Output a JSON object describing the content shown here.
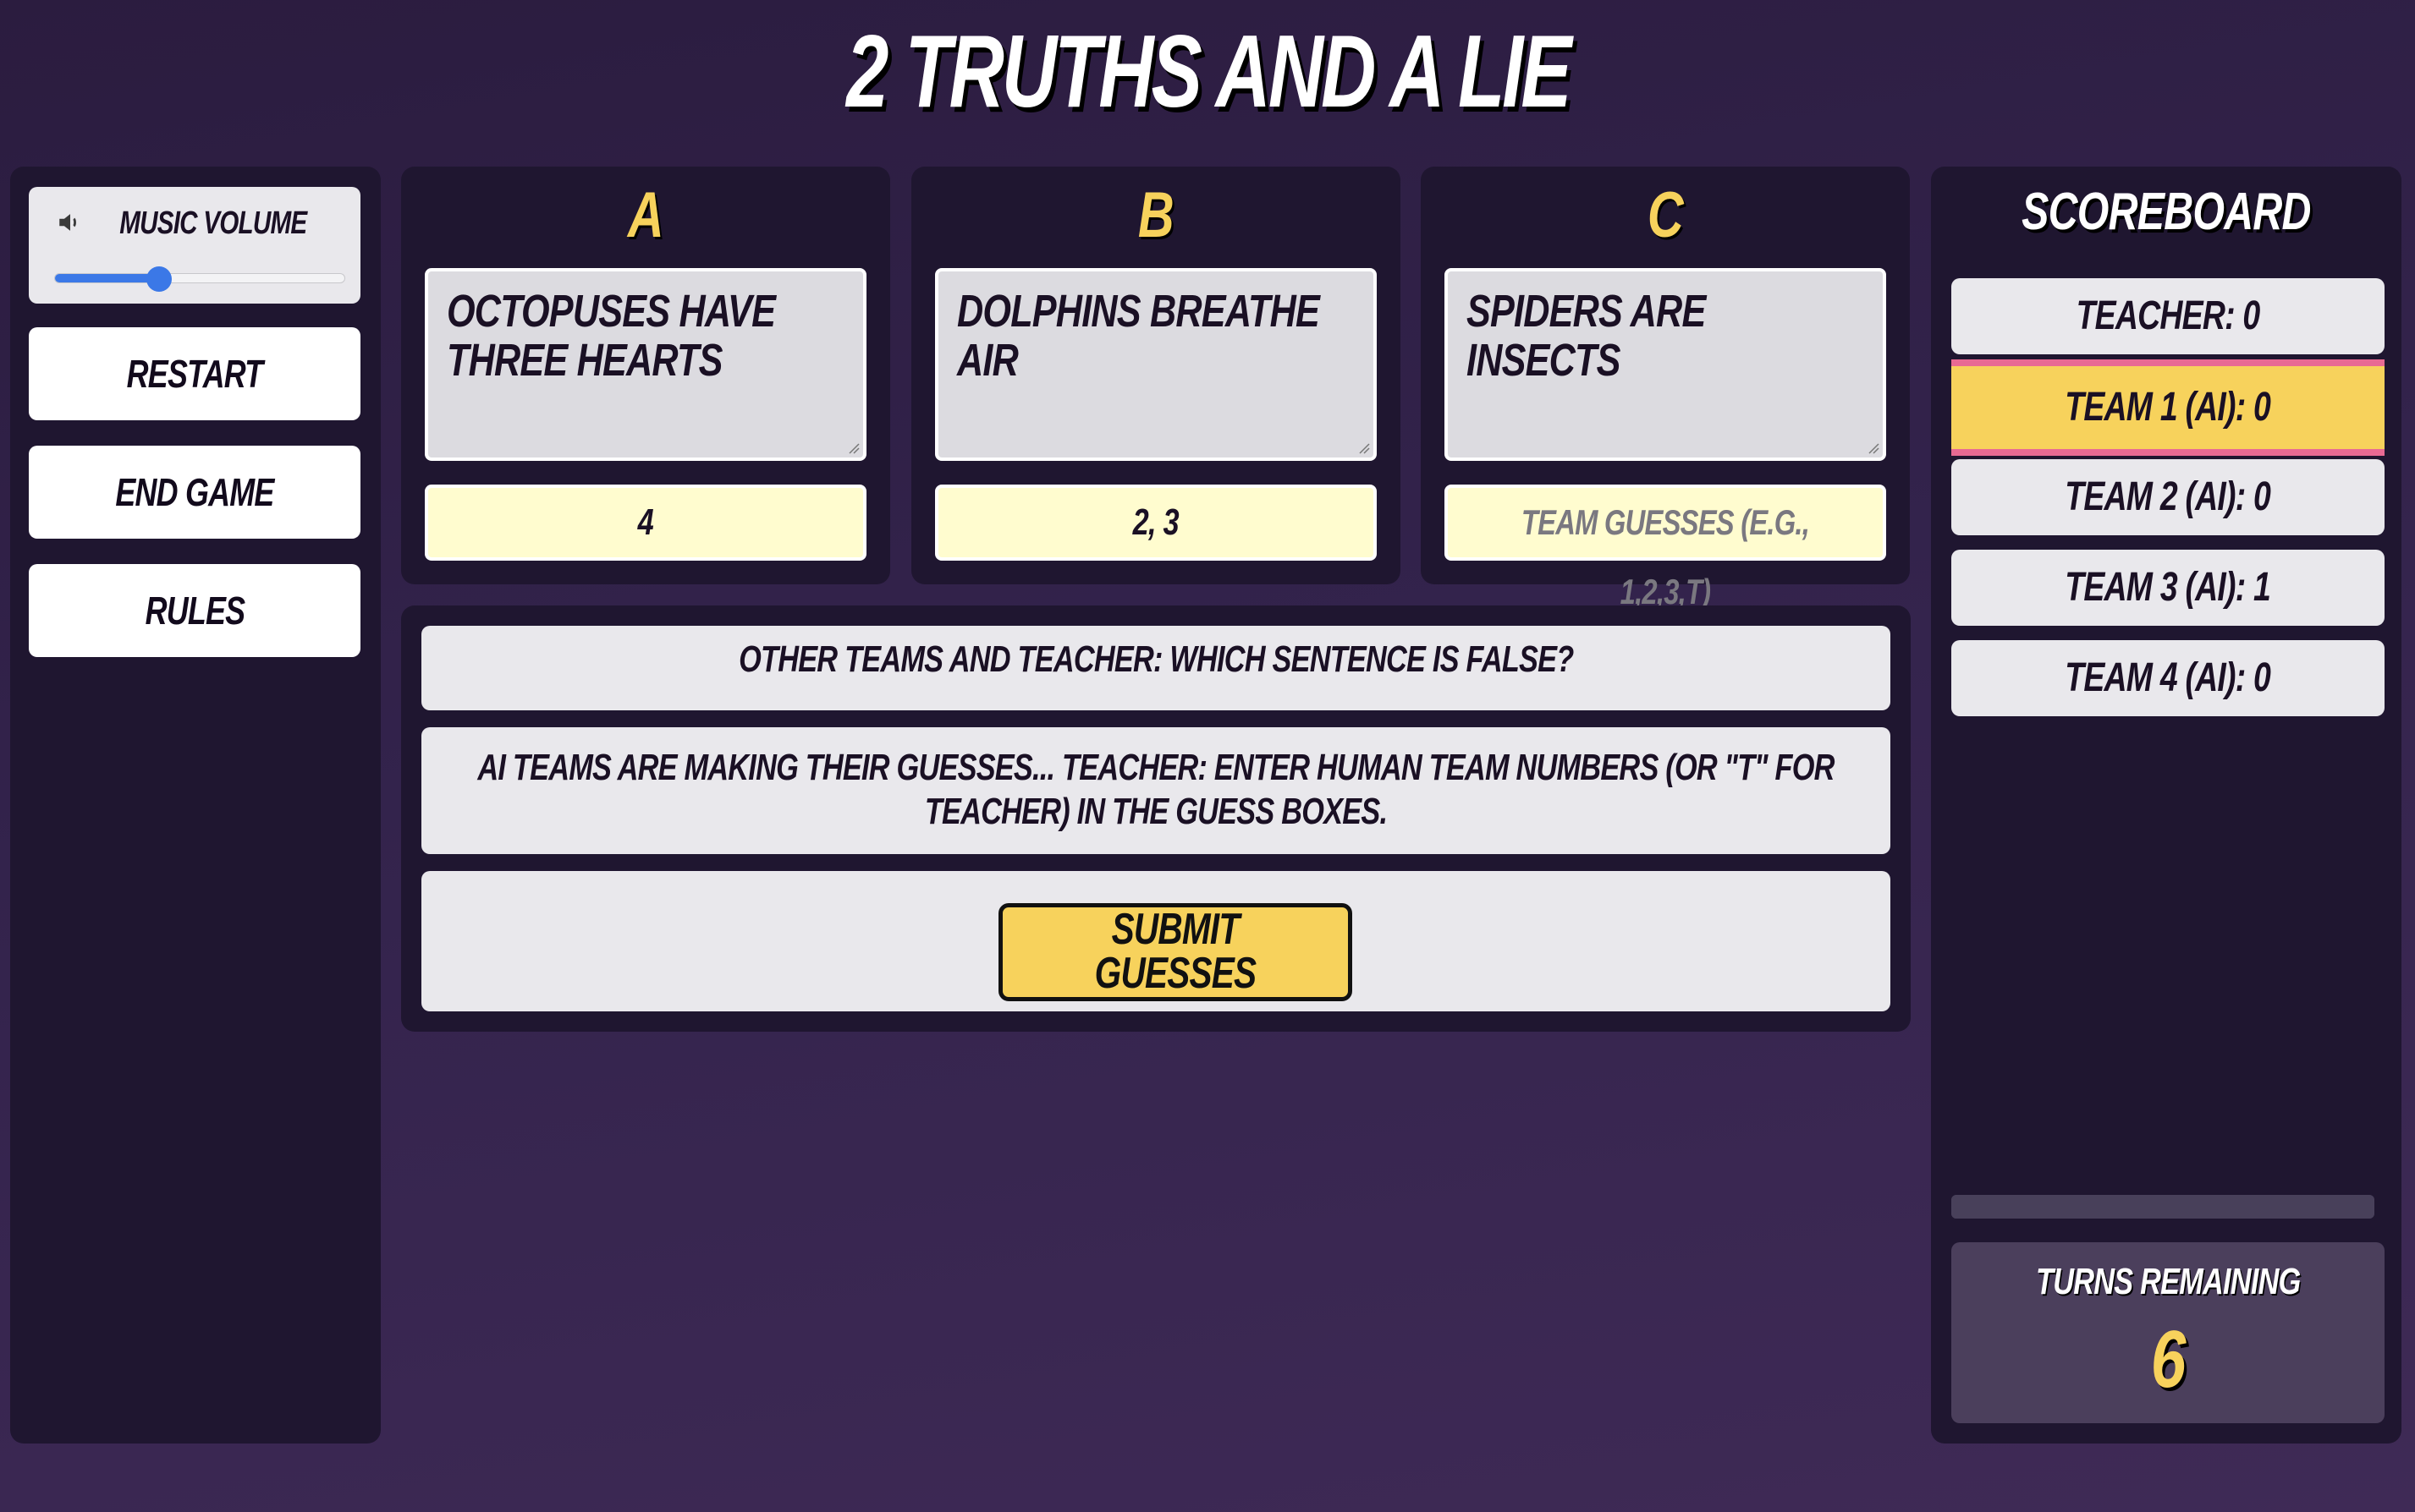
{
  "header": {
    "title": "2 TRUTHS AND A LIE"
  },
  "sidebar": {
    "music": {
      "label": "MUSIC VOLUME",
      "icon": "speaker-icon",
      "volume": 0.36
    },
    "buttons": [
      {
        "label": "RESTART"
      },
      {
        "label": "END GAME"
      },
      {
        "label": "RULES"
      }
    ]
  },
  "statements": [
    {
      "letter": "A",
      "text": "OCTOPUSES HAVE THREE HEARTS",
      "guess": "4",
      "guess_placeholder": "TEAM GUESSES (E.G., 1,2,3,T)"
    },
    {
      "letter": "B",
      "text": "DOLPHINS BREATHE AIR",
      "guess": "2, 3",
      "guess_placeholder": "TEAM GUESSES (E.G., 1,2,3,T)"
    },
    {
      "letter": "C",
      "text": "SPIDERS ARE INSECTS",
      "guess": "",
      "guess_placeholder": "TEAM GUESSES (E.G., 1,2,3,T)"
    }
  ],
  "messages": {
    "prompt": "OTHER TEAMS AND TEACHER: WHICH SENTENCE IS FALSE?",
    "instructions": "AI TEAMS ARE MAKING THEIR GUESSES... TEACHER: ENTER HUMAN TEAM NUMBERS (OR \"T\" FOR TEACHER) IN THE GUESS BOXES.",
    "submit_label": "SUBMIT GUESSES"
  },
  "scoreboard": {
    "title": "SCOREBOARD",
    "rows": [
      {
        "label": "TEACHER: 0",
        "active": false
      },
      {
        "label": "TEAM 1 (AI): 0",
        "active": true
      },
      {
        "label": "TEAM 2 (AI): 0",
        "active": false
      },
      {
        "label": "TEAM 3 (AI): 1",
        "active": false
      },
      {
        "label": "TEAM 4 (AI): 0",
        "active": false
      }
    ],
    "turns_label": "TURNS REMAINING",
    "turns_value": "6"
  },
  "colors": {
    "accent": "#f7d25c",
    "active_border": "#e86a93",
    "panel": "#1f1630",
    "slider": "#3b78e7"
  }
}
